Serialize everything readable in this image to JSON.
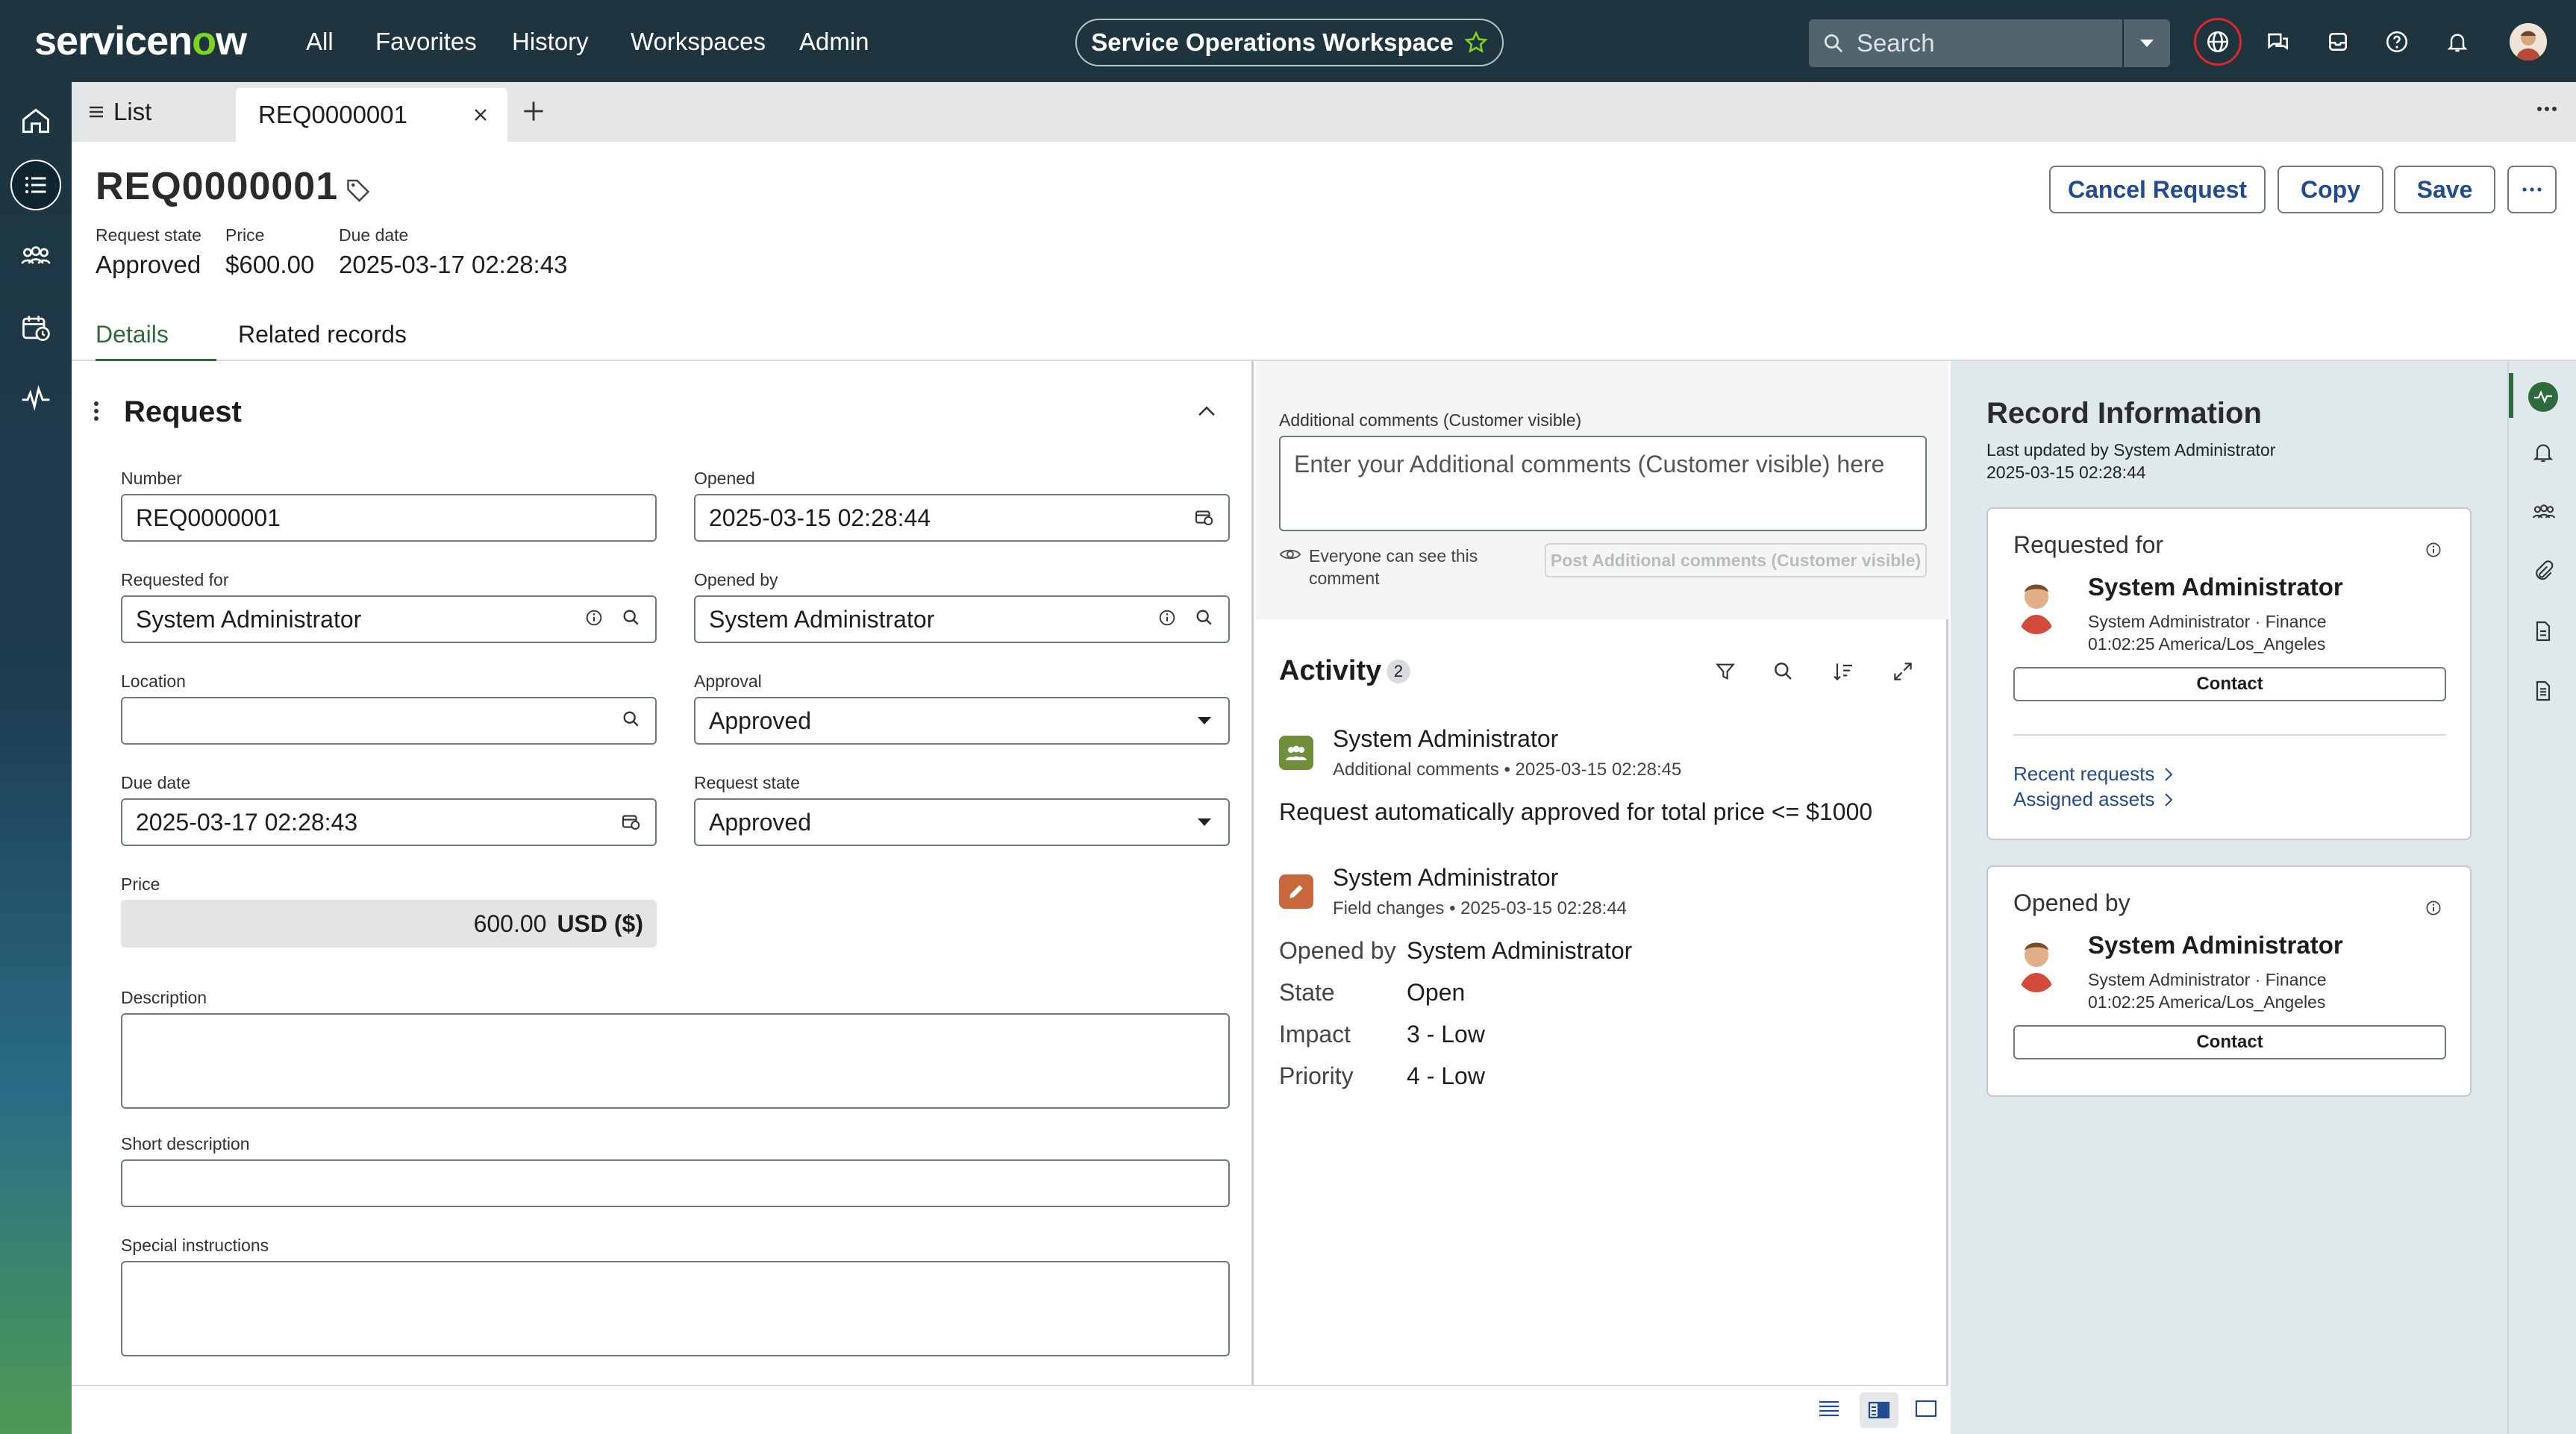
{
  "topbar": {
    "logo": "servicenow",
    "nav": [
      "All",
      "Favorites",
      "History",
      "Workspaces",
      "Admin"
    ],
    "workspace": "Service Operations Workspace",
    "search_placeholder": "Search"
  },
  "tabs": {
    "list_label": "List",
    "record_label": "REQ0000001"
  },
  "record": {
    "number": "REQ0000001",
    "header_fields": [
      {
        "label": "Request state",
        "value": "Approved"
      },
      {
        "label": "Price",
        "value": "$600.00"
      },
      {
        "label": "Due date",
        "value": "2025-03-17 02:28:43"
      }
    ],
    "buttons": {
      "cancel": "Cancel Request",
      "copy": "Copy",
      "save": "Save"
    }
  },
  "form_tabs": {
    "details": "Details",
    "related": "Related records"
  },
  "form": {
    "section_title": "Request",
    "number": {
      "label": "Number",
      "value": "REQ0000001"
    },
    "opened": {
      "label": "Opened",
      "value": "2025-03-15 02:28:44"
    },
    "requested_for": {
      "label": "Requested for",
      "value": "System Administrator"
    },
    "opened_by": {
      "label": "Opened by",
      "value": "System Administrator"
    },
    "location": {
      "label": "Location",
      "value": ""
    },
    "approval": {
      "label": "Approval",
      "value": "Approved"
    },
    "due_date": {
      "label": "Due date",
      "value": "2025-03-17 02:28:43"
    },
    "request_state": {
      "label": "Request state",
      "value": "Approved"
    },
    "price": {
      "label": "Price",
      "value": "600.00",
      "currency": "USD ($)"
    },
    "description": {
      "label": "Description"
    },
    "short_description": {
      "label": "Short description"
    },
    "special_instructions": {
      "label": "Special instructions"
    }
  },
  "comments": {
    "label": "Additional comments (Customer visible)",
    "placeholder": "Enter your Additional comments (Customer visible) here",
    "visibility_note": "Everyone can see this comment",
    "post_button": "Post Additional comments (Customer visible)"
  },
  "activity": {
    "title": "Activity",
    "count": "2",
    "entries": [
      {
        "author": "System Administrator",
        "meta": "Additional comments • 2025-03-15 02:28:45",
        "body": "Request automatically approved for total price <= $1000"
      },
      {
        "author": "System Administrator",
        "meta": "Field changes • 2025-03-15 02:28:44",
        "changes": [
          {
            "field": "Opened by",
            "value": "System Administrator"
          },
          {
            "field": "State",
            "value": "Open"
          },
          {
            "field": "Impact",
            "value": "3 - Low"
          },
          {
            "field": "Priority",
            "value": "4 - Low"
          }
        ]
      }
    ]
  },
  "record_info": {
    "title": "Record Information",
    "updated_by": "Last updated by System Administrator",
    "updated_at": "2025-03-15 02:28:44",
    "requested_for_card": {
      "heading": "Requested for",
      "name": "System Administrator",
      "dept": "System Administrator · Finance",
      "timezone": "01:02:25 America/Los_Angeles",
      "contact": "Contact",
      "links": [
        "Recent requests",
        "Assigned assets"
      ]
    },
    "opened_by_card": {
      "heading": "Opened by",
      "name": "System Administrator",
      "dept": "System Administrator · Finance",
      "timezone": "01:02:25 America/Los_Angeles",
      "contact": "Contact"
    }
  },
  "colors": {
    "topbar": "#1e3540",
    "accent_green": "#2e6b3c",
    "link_blue": "#234b8f",
    "info_pane": "#dfe9eb"
  }
}
